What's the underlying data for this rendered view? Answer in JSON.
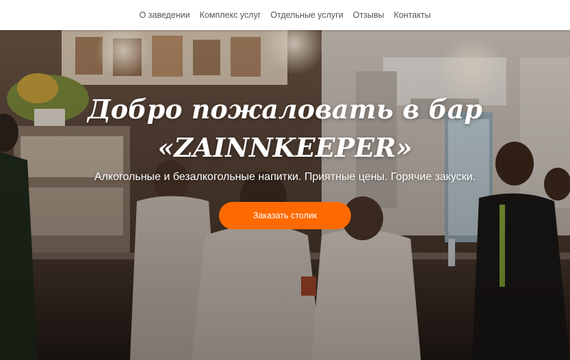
{
  "nav": {
    "items": [
      {
        "label": "О заведении"
      },
      {
        "label": "Комплекс услуг"
      },
      {
        "label": "Отдельные услуги"
      },
      {
        "label": "Отзывы"
      },
      {
        "label": "Контакты"
      }
    ]
  },
  "hero": {
    "title_line1": "Добро пожаловать в бар",
    "title_line2": "«ZAINNKEEPER»",
    "subtitle": "Алкогольные и безалкогольные напитки. Приятные цены. Горячие закуски.",
    "cta_label": "Заказать столик"
  },
  "colors": {
    "accent": "#ff6a00",
    "nav_text": "#555555",
    "nav_bg": "#ffffff",
    "hero_text": "#ffffff"
  }
}
